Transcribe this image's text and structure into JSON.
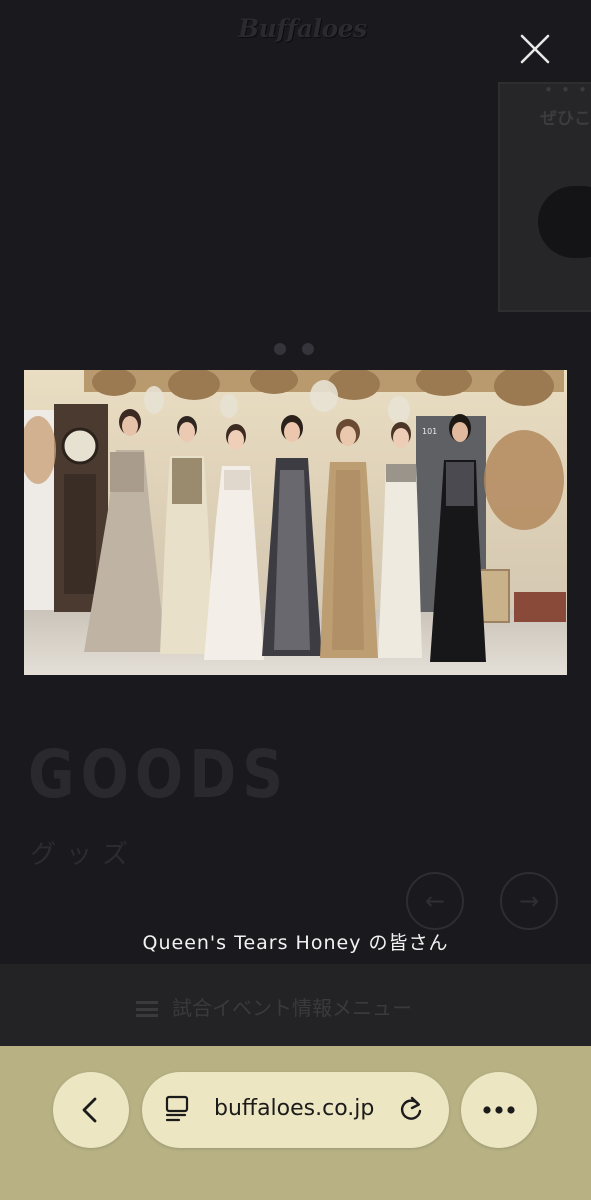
{
  "background_page": {
    "logo_text": "Buffaloes",
    "card_text_top": "ぜひご",
    "card_text": "ぜひこ",
    "section_heading": "GOODS",
    "section_heading_jp": "グッズ",
    "menu_label": "試合イベント情報メニュー"
  },
  "lightbox": {
    "caption": "Queen's Tears Honey の皆さん",
    "photo_subject": "seven women in evening gowns",
    "door_number": "101"
  },
  "browser": {
    "url": "buffaloes.co.jp"
  },
  "colors": {
    "overlay": "#121216",
    "toolbar": "#b7b184",
    "toolbar_button": "#ece6c2",
    "caption": "#f2f2f2"
  }
}
